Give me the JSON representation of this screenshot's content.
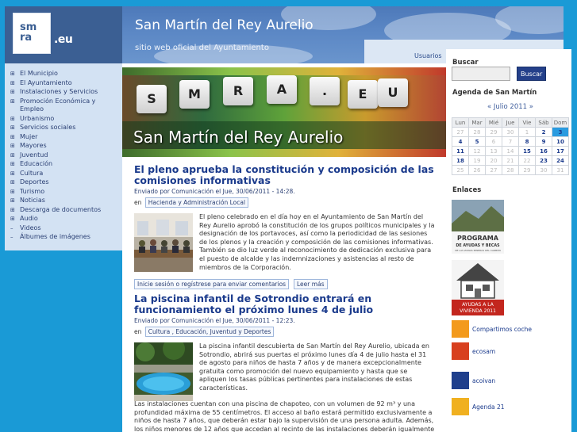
{
  "logo": {
    "line1": "sm",
    "line2": "ra",
    "suffix": ".eu"
  },
  "header": {
    "title": "San Martín del Rey Aurelio",
    "subtitle": "sitio web oficial del Ayuntamiento",
    "users_link": "Usuarios"
  },
  "nav": {
    "items": [
      {
        "marker": "⊞",
        "label": "El Municipio"
      },
      {
        "marker": "⊞",
        "label": "El Ayuntamiento"
      },
      {
        "marker": "⊞",
        "label": "Instalaciones y Servicios"
      },
      {
        "marker": "⊞",
        "label": "Promoción Económica y Empleo"
      },
      {
        "marker": "⊞",
        "label": "Urbanismo"
      },
      {
        "marker": "⊞",
        "label": "Servicios sociales"
      },
      {
        "marker": "⊞",
        "label": "Mujer"
      },
      {
        "marker": "⊞",
        "label": "Mayores"
      },
      {
        "marker": "⊞",
        "label": "Juventud"
      },
      {
        "marker": "⊞",
        "label": "Educación"
      },
      {
        "marker": "⊞",
        "label": "Cultura"
      },
      {
        "marker": "⊞",
        "label": "Deportes"
      },
      {
        "marker": "⊞",
        "label": "Turismo"
      },
      {
        "marker": "⊞",
        "label": "Noticias"
      },
      {
        "marker": "⊞",
        "label": "Descarga de documentos"
      },
      {
        "marker": "⊞",
        "label": "Audio"
      },
      {
        "marker": "–",
        "label": "Videos"
      },
      {
        "marker": "–",
        "label": "Álbumes de imágenes"
      }
    ]
  },
  "banner": {
    "keys": [
      "S",
      "M",
      "R",
      "A",
      ".",
      "E",
      "U"
    ],
    "title": "San Martín del Rey Aurelio"
  },
  "articles": [
    {
      "title": "El pleno aprueba la constitución y composición de las comisiones informativas",
      "meta": "Enviado por Comunicación el Jue, 30/06/2011 - 14:28.",
      "tags_prefix": "en",
      "tags": [
        "Hacienda y Administración Local"
      ],
      "paragraphs": [
        "El pleno celebrado en el día hoy en el Ayuntamiento de San Martín del Rey Aurelio aprobó la constitución de los grupos políticos municipales y la designación de los portavoces, así como la periodicidad de las sesiones de los plenos y la creación y composición de las comisiones informativas. También se dio luz verde al reconocimiento de dedicación exclusiva para el puesto de alcalde y las indemnizaciones y asistencias al resto de miembros de la Corporación."
      ],
      "links": [
        "Inicie sesión o regístrese para enviar comentarios",
        "Leer más"
      ]
    },
    {
      "title": "La piscina infantil de Sotrondio entrará en funcionamiento el próximo lunes 4 de julio",
      "meta": "Enviado por Comunicación el Jue, 30/06/2011 - 12:23.",
      "tags_prefix": "en",
      "tags": [
        "Cultura , Educación, Juventud y Deportes"
      ],
      "paragraphs": [
        "La piscina infantil descubierta de San Martín del Rey Aurelio, ubicada en Sotrondio, abrirá sus puertas el próximo lunes día 4 de julio hasta el 31 de agosto para niños de hasta 7 años y de manera excepcionalmente gratuita como promoción del nuevo equipamiento y hasta que se apliquen los tasas públicas pertinentes para instalaciones de estas características.",
        "Las instalaciones cuentan con una piscina de chapoteo, con un volumen de 92 m³ y una profundidad máxima de 55 centímetros. El acceso al baño estará permitido exclusivamente a niños de hasta 7 años, que deberán estar bajo la supervisión de una persona adulta. Además, los niños menores de 12 años que accedan al recinto de las instalaciones deberán igualmente estar acompañados de un adulto."
      ]
    }
  ],
  "sidebar": {
    "search_heading": "Buscar",
    "search_value": "",
    "search_button": "Buscar",
    "agenda_heading": "Agenda de San Martín",
    "calendar": {
      "prev": "«",
      "month": "Julio 2011",
      "next": "»",
      "weekdays": [
        "Lun",
        "Mar",
        "Mié",
        "Jue",
        "Vie",
        "Sáb",
        "Dom"
      ],
      "weeks": [
        [
          {
            "d": "27",
            "s": "o"
          },
          {
            "d": "28",
            "s": "o"
          },
          {
            "d": "29",
            "s": "o"
          },
          {
            "d": "30",
            "s": "o"
          },
          {
            "d": "1",
            "s": "o"
          },
          {
            "d": "2",
            "s": "l"
          },
          {
            "d": "3",
            "s": "t"
          }
        ],
        [
          {
            "d": "4",
            "s": "l"
          },
          {
            "d": "5",
            "s": "l"
          },
          {
            "d": "6",
            "s": "o"
          },
          {
            "d": "7",
            "s": "o"
          },
          {
            "d": "8",
            "s": "l"
          },
          {
            "d": "9",
            "s": "l"
          },
          {
            "d": "10",
            "s": "l"
          }
        ],
        [
          {
            "d": "11",
            "s": "l"
          },
          {
            "d": "12",
            "s": "o"
          },
          {
            "d": "13",
            "s": "o"
          },
          {
            "d": "14",
            "s": "o"
          },
          {
            "d": "15",
            "s": "l"
          },
          {
            "d": "16",
            "s": "l"
          },
          {
            "d": "17",
            "s": "l"
          }
        ],
        [
          {
            "d": "18",
            "s": "l"
          },
          {
            "d": "19",
            "s": "o"
          },
          {
            "d": "20",
            "s": "o"
          },
          {
            "d": "21",
            "s": "o"
          },
          {
            "d": "22",
            "s": "o"
          },
          {
            "d": "23",
            "s": "l"
          },
          {
            "d": "24",
            "s": "l"
          }
        ],
        [
          {
            "d": "25",
            "s": "o"
          },
          {
            "d": "26",
            "s": "o"
          },
          {
            "d": "27",
            "s": "o"
          },
          {
            "d": "28",
            "s": "o"
          },
          {
            "d": "29",
            "s": "o"
          },
          {
            "d": "30",
            "s": "o"
          },
          {
            "d": "31",
            "s": "o"
          }
        ]
      ]
    },
    "links_heading": "Enlaces",
    "banner1": {
      "line1": "PROGRAMA",
      "line2": "DE AYUDAS Y BECAS",
      "small": "DE LAS ZONAS MINERAS DEL CARBÓN"
    },
    "banner2": {
      "line1": "AYUDAS A LA",
      "line2": "VIVIENDA 2011"
    },
    "partners": [
      {
        "icon": "car-icon",
        "name": "Compartimos coche",
        "color": "#f39a1c"
      },
      {
        "icon": "ecosam-icon",
        "name": "ecosam",
        "color": "#d8401f"
      },
      {
        "icon": "acoivan-icon",
        "name": "acoivan",
        "color": "#1f3f8c"
      },
      {
        "icon": "sunrise-icon",
        "name": "Agenda 21",
        "color": "#f0b020"
      }
    ]
  }
}
